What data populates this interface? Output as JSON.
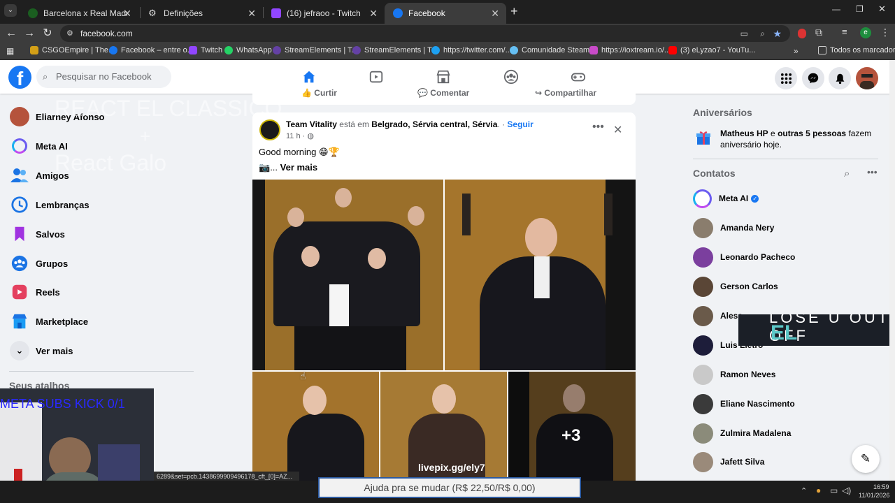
{
  "browser": {
    "tabs": [
      {
        "title": "Barcelona x Real Madrid - Final",
        "icon": "soccer-site-icon",
        "color": "#1b5e20"
      },
      {
        "title": "Definições",
        "icon": "gear-icon",
        "color": "#9e9e9e"
      },
      {
        "title": "(16) jefraoo - Twitch",
        "icon": "twitch-icon",
        "color": "#9146ff"
      },
      {
        "title": "Facebook",
        "icon": "facebook-icon",
        "color": "#1877f2"
      }
    ],
    "new_tab": "+",
    "url": "facebook.com",
    "bookmarks": [
      {
        "label": "CSGOEmpire | The...",
        "color": "#d4a017"
      },
      {
        "label": "Facebook – entre o...",
        "color": "#1877f2"
      },
      {
        "label": "Twitch",
        "color": "#9146ff"
      },
      {
        "label": "WhatsApp",
        "color": "#25d366"
      },
      {
        "label": "StreamElements | T...",
        "color": "#6441a5"
      },
      {
        "label": "StreamElements | T...",
        "color": "#6441a5"
      },
      {
        "label": "https://twitter.com/...",
        "color": "#1da1f2"
      },
      {
        "label": "Comunidade Steam...",
        "color": "#66c0f4"
      },
      {
        "label": "https://ioxtream.io/...",
        "color": "#c94bc9"
      },
      {
        "label": "(3) eLyzao7 - YouTu...",
        "color": "#ff0000"
      }
    ],
    "all_bookmarks": "Todos os marcadores",
    "profile_letter": "e"
  },
  "facebook": {
    "search_placeholder": "Pesquisar no Facebook",
    "sidebar": [
      {
        "label": "Eliarney Afonso",
        "icon": "avatar"
      },
      {
        "label": "Meta AI",
        "icon": "meta-ai-icon"
      },
      {
        "label": "Amigos",
        "icon": "friends-icon"
      },
      {
        "label": "Lembranças",
        "icon": "memories-icon"
      },
      {
        "label": "Salvos",
        "icon": "saved-icon"
      },
      {
        "label": "Grupos",
        "icon": "groups-icon"
      },
      {
        "label": "Reels",
        "icon": "reels-icon"
      },
      {
        "label": "Marketplace",
        "icon": "marketplace-icon"
      },
      {
        "label": "Ver mais",
        "icon": "chevron-down-icon"
      }
    ],
    "shortcuts_title": "Seus atalhos",
    "prev_post_actions": [
      "Curtir",
      "Comentar",
      "Compartilhar"
    ],
    "post": {
      "author": "Team Vitality",
      "location_prefix": "está em",
      "location": "Belgrado, Sérvia central, Sérvia",
      "follow": "Seguir",
      "time": "11 h",
      "text": "Good morning 😁🏆",
      "see_more": "Ver mais",
      "more_photos": "+3"
    },
    "birthdays": {
      "title": "Aniversários",
      "name": "Matheus HP",
      "connector": "e",
      "others": "outras 5 pessoas",
      "suffix": "fazem aniversário hoje."
    },
    "contacts_title": "Contatos",
    "contacts": [
      {
        "name": "Meta AI",
        "color": "#5b6cf0"
      },
      {
        "name": "Amanda Nery",
        "color": "#8a7d6d"
      },
      {
        "name": "Leonardo Pacheco",
        "color": "#7b3f9e"
      },
      {
        "name": "Gerson Carlos",
        "color": "#5a4636"
      },
      {
        "name": "Aless",
        "color": "#6a5a4a"
      },
      {
        "name": "Luis Lietro",
        "color": "#1d1d3a"
      },
      {
        "name": "Ramon Neves",
        "color": "#c9c9c9"
      },
      {
        "name": "Eliane Nascimento",
        "color": "#3a3a3a"
      },
      {
        "name": "Zulmira Madalena",
        "color": "#8b8b7a"
      },
      {
        "name": "Jafett Silva",
        "color": "#9a8a7a"
      }
    ]
  },
  "overlays": {
    "react_text_1": "REACT EL CLASSICO",
    "react_plus": "+",
    "react_text_2": "React Galo",
    "subs_kick": "META SUBS KICK 0/1",
    "status_url": "6289&set=pcb.1438699909496178_cft_[0]=AZ...",
    "livepix": "livepix.gg/ely7",
    "donation": "Ajuda pra se mudar (R$ 22,50/R$ 0,00)",
    "banner_logo": "EL",
    "clock_time": "16:59",
    "clock_date": "11/01/2026"
  }
}
